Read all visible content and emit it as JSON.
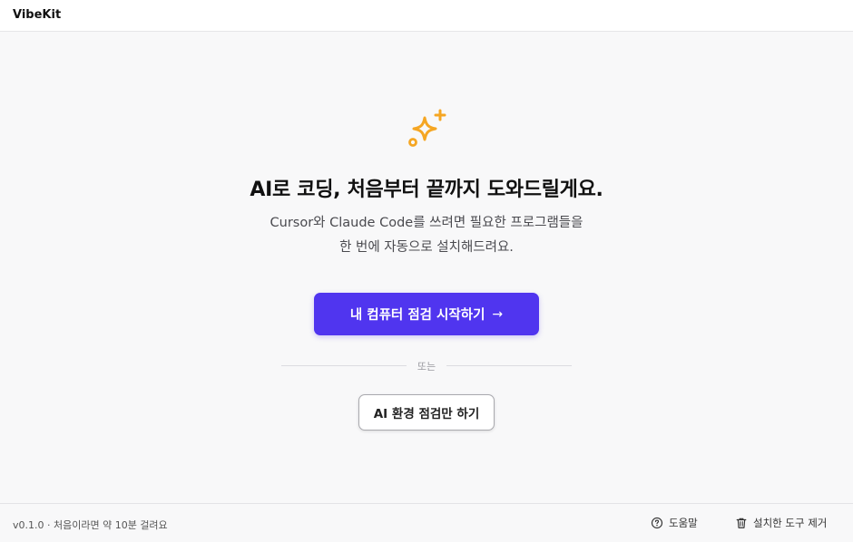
{
  "app": {
    "name": "VibeKit"
  },
  "hero": {
    "icon": "sparkles-icon",
    "accent_color": "#f5a623",
    "title": "AI로 코딩, 처음부터 끝까지 도와드릴게요.",
    "subtitle_line1": "Cursor와 Claude Code를 쓰려면 필요한 프로그램들을",
    "subtitle_line2": "한 번에 자동으로 설치해드려요."
  },
  "actions": {
    "primary_label": "내 컴퓨터 점검 시작하기",
    "primary_color": "#5035ef",
    "primary_arrow": "→",
    "divider_text": "또는",
    "secondary_label": "AI 환경 점검만 하기"
  },
  "footer": {
    "version_text": "v0.1.0 · 처음이라면 약 10분 걸려요",
    "help_label": "도움말",
    "help_icon": "help-circle-icon",
    "remove_label": "설치한 도구 제거",
    "remove_icon": "trash-icon"
  }
}
